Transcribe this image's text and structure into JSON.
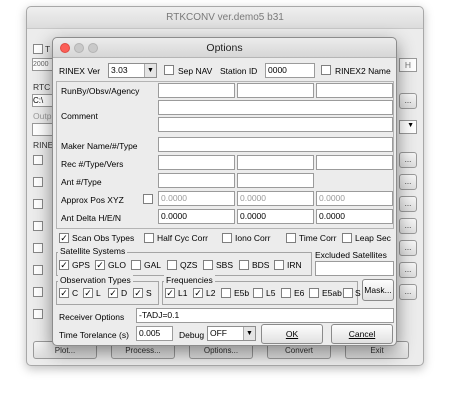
{
  "bg_window": {
    "title": "RTKCONV ver.demo5 b31",
    "left_labels": [
      "T",
      "2000",
      "RTC",
      "C:\\",
      "Outp",
      "RINE"
    ],
    "right_letter": "H",
    "ellipsis": "...",
    "bottom_buttons": [
      "Plot...",
      "Process...",
      "Options...",
      "Convert",
      "Exit"
    ]
  },
  "dialog": {
    "title": "Options",
    "rinex_ver_label": "RINEX Ver",
    "rinex_ver_value": "3.03",
    "sep_nav_label": "Sep NAV",
    "station_id_label": "Station ID",
    "station_id_value": "0000",
    "rinex2_name_label": "RINEX2 Name",
    "runby_label": "RunBy/Obsv/Agency",
    "comment_label": "Comment",
    "marker_label": "Maker Name/#/Type",
    "rec_label": "Rec #/Type/Vers",
    "ant_label": "Ant #/Type",
    "approx_label": "Approx Pos XYZ",
    "approx_values": [
      "0.0000",
      "0.0000",
      "0.0000"
    ],
    "ant_delta_label": "Ant Delta H/E/N",
    "ant_delta_values": [
      "0.0000",
      "0.0000",
      "0.0000"
    ],
    "opts_row": [
      "Scan Obs Types",
      "Half Cyc Corr",
      "Iono Corr",
      "Time Corr",
      "Leap Sec"
    ],
    "opts_checked": [
      true,
      false,
      false,
      false,
      false
    ],
    "satellite_systems_title": "Satellite Systems",
    "systems": [
      "GPS",
      "GLO",
      "GAL",
      "QZS",
      "SBS",
      "BDS",
      "IRN"
    ],
    "systems_checked": [
      true,
      true,
      false,
      false,
      false,
      false,
      false
    ],
    "excluded_sat_label": "Excluded Satellites",
    "obs_types_title": "Observation Types",
    "obs_types": [
      "C",
      "L",
      "D",
      "S"
    ],
    "obs_checked": [
      true,
      true,
      true,
      true
    ],
    "freq_title": "Frequencies",
    "freqs": [
      "L1",
      "L2",
      "E5b",
      "L5",
      "E6",
      "E5ab",
      "S"
    ],
    "freqs_checked": [
      true,
      true,
      false,
      false,
      false,
      false,
      false
    ],
    "mask_button": "Mask...",
    "receiver_options_label": "Receiver Options",
    "receiver_options_value": "-TADJ=0.1",
    "time_tol_label": "Time Torelance (s)",
    "time_tol_value": "0.005",
    "debug_label": "Debug",
    "debug_value": "OFF",
    "ok_button": "OK",
    "cancel_button": "Cancel"
  },
  "colors": {
    "close": "#fc5f57",
    "minimize": "#fdbc2e",
    "zoom": "#c8c8c8"
  }
}
